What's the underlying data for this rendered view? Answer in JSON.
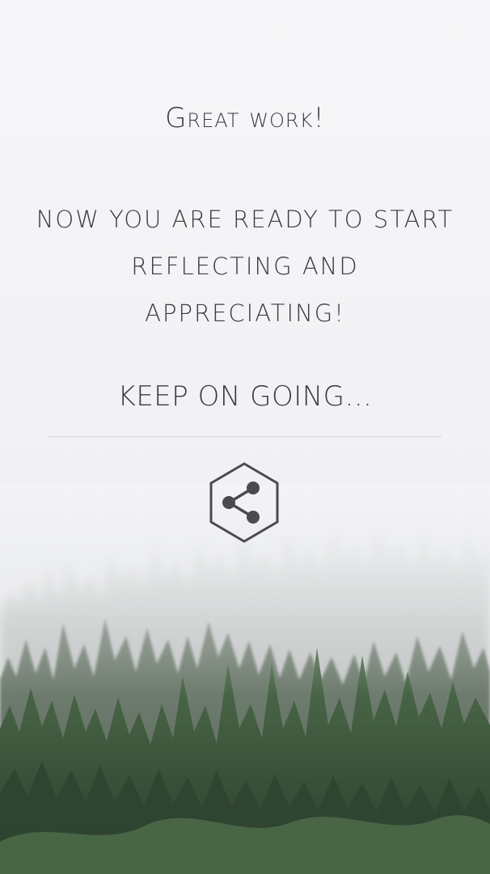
{
  "completion": {
    "heading": "Great work!",
    "message_lines": [
      "now you are ready to start",
      "reflecting and",
      "appreciating!"
    ],
    "keep_going": "KEEP ON GOING..."
  },
  "share": {
    "icon": "share-icon",
    "frame": "hexagon-outline"
  },
  "background": {
    "image": "misty-pine-forest",
    "colors": {
      "sky": "#f7f7f9",
      "forest_dark": "#2b3a2c",
      "forest_mid": "#4e6b4a",
      "forest_light": "#7d9b72",
      "text": "#3b3b40",
      "divider": "#d6d6da",
      "icon": "#4a4a4f"
    }
  }
}
